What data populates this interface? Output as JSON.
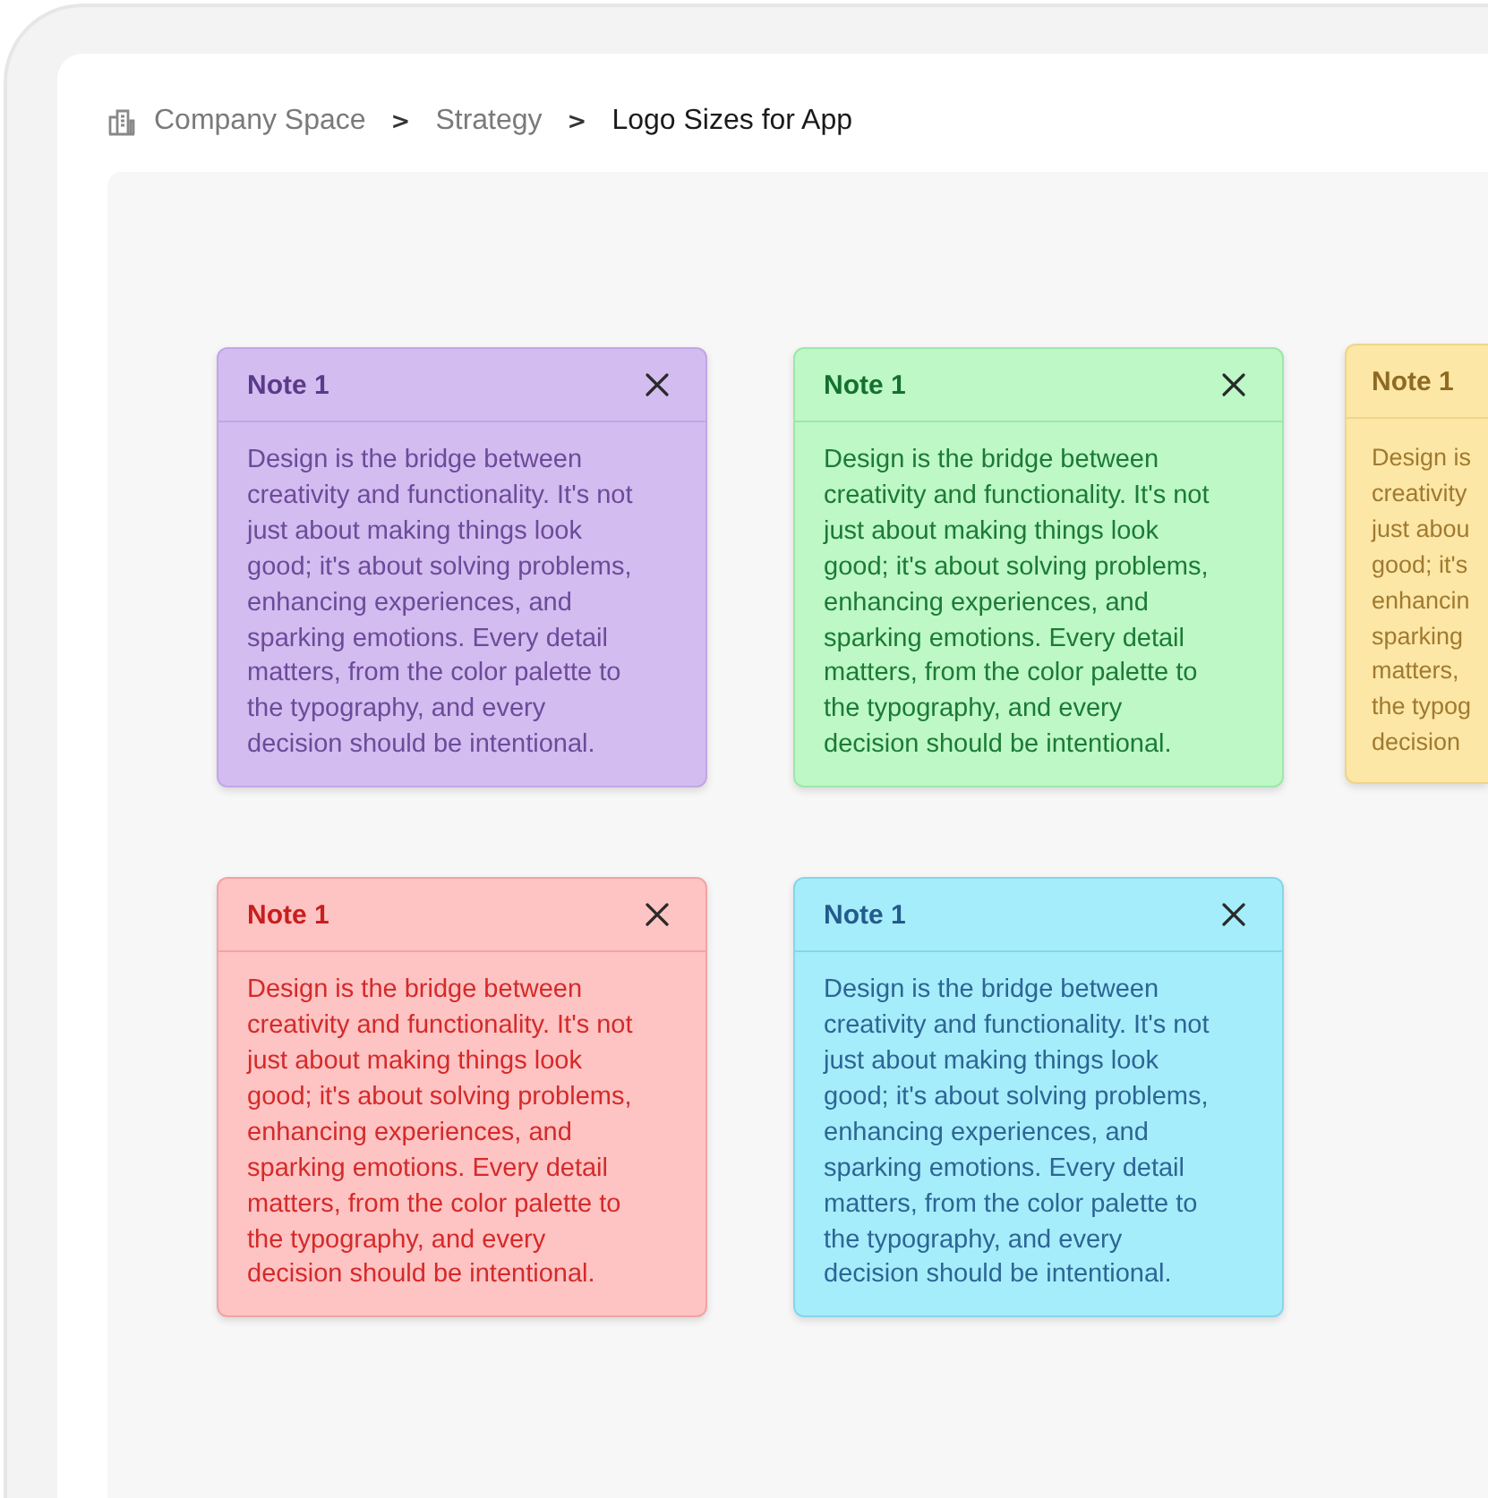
{
  "breadcrumb": [
    {
      "label": "Company Space",
      "current": false
    },
    {
      "label": "Strategy",
      "current": false
    },
    {
      "label": "Logo Sizes for App",
      "current": true
    }
  ],
  "separator": ">",
  "note_rows": [
    [
      {
        "kind": "full",
        "title": "Note 1",
        "color": "#d3bcef",
        "lines": [
          "Design is the bridge between",
          "creativity and functionality. It's not",
          "just about making things look",
          "good; it's about solving problems,",
          "enhancing experiences, and",
          "sparking emotions. Every detail",
          "matters, from the color palette to",
          "the typography, and every",
          "decision should be intentional."
        ]
      },
      {
        "kind": "full",
        "title": "Note 1",
        "color": "#bdf8c6",
        "lines": [
          "Design is the bridge between",
          "creativity and functionality. It's not",
          "just about making things look",
          "good; it's about solving problems,",
          "enhancing experiences, and",
          "sparking emotions. Every detail",
          "matters, from the color palette to",
          "the typography, and every",
          "decision should be intentional."
        ]
      },
      {
        "kind": "clipped",
        "title": "Note 1",
        "color": "#fde7a6",
        "lines": [
          "Design is",
          "creativity",
          "just abou",
          "good; it's",
          "enhancin",
          "sparking",
          "matters,",
          "the typog",
          "decision"
        ]
      }
    ],
    [
      {
        "kind": "full",
        "title": "Note 1",
        "color": "#fec3c3",
        "lines": [
          "Design is the bridge between",
          "creativity and functionality. It's not",
          "just about making things look",
          "good; it's about solving problems,",
          "enhancing experiences, and",
          "sparking emotions. Every detail",
          "matters, from the color palette to",
          "the typography, and every",
          "decision should be intentional."
        ]
      },
      {
        "kind": "full",
        "title": "Note 1",
        "color": "#a6edfb",
        "lines": [
          "Design is the bridge between",
          "creativity and functionality. It's not",
          "just about making things look",
          "good; it's about solving problems,",
          "enhancing experiences, and",
          "sparking emotions. Every detail",
          "matters, from the color palette to",
          "the typography, and every",
          "decision should be intentional."
        ]
      }
    ]
  ]
}
